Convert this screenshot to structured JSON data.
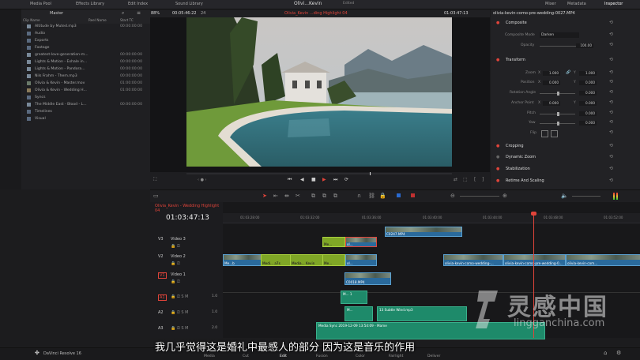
{
  "topbar": {
    "tabs": [
      "Media Pool",
      "Effects Library",
      "Edit Index",
      "Sound Library"
    ],
    "title": "Olivi...Kevin",
    "subtitle": "Edited",
    "right_tabs": [
      "Mixer",
      "Metadata",
      "Inspector"
    ]
  },
  "media_pool": {
    "bin": "Master",
    "col_clip": "Clip Name",
    "col_reel": "Reel Name",
    "col_start": "Start TC",
    "items": [
      {
        "name": "Altitude by Muted.mp3",
        "tc": "00:00:00:00",
        "kind": "audio"
      },
      {
        "name": "Audio",
        "tc": "",
        "kind": "folder"
      },
      {
        "name": "Exports",
        "tc": "",
        "kind": "folder"
      },
      {
        "name": "Footage",
        "tc": "",
        "kind": "folder"
      },
      {
        "name": "greatest-love-generation-m...",
        "tc": "00:00:00:00",
        "kind": "audio"
      },
      {
        "name": "Lights & Motion - Exhale in...",
        "tc": "00:00:00:00",
        "kind": "audio"
      },
      {
        "name": "Lights & Motion - Pandora...",
        "tc": "00:00:00:00",
        "kind": "audio"
      },
      {
        "name": "Nils Frahm - Them.mp3",
        "tc": "00:00:00:00",
        "kind": "audio"
      },
      {
        "name": "Olivia & Kevin - Master.mov",
        "tc": "01:00:00:00",
        "kind": "video"
      },
      {
        "name": "Olivia & Kevin - Wedding H...",
        "tc": "01:00:00:00",
        "kind": "timeline"
      },
      {
        "name": "Syncs",
        "tc": "",
        "kind": "folder"
      },
      {
        "name": "The Middle East - Blood - L...",
        "tc": "00:00:00:00",
        "kind": "audio"
      },
      {
        "name": "Timelines",
        "tc": "",
        "kind": "folder"
      },
      {
        "name": "Visual",
        "tc": "",
        "kind": "folder"
      }
    ]
  },
  "viewer": {
    "zoom": "88%",
    "source_tc": "00:05:46:22",
    "fps": "24",
    "timeline_name": "Olivia_Kevin ...ding Highlight 04",
    "record_tc": "01:03:47:13"
  },
  "inspector": {
    "clip": "olivia-kevin-como-pre-wedding-0027.MP4",
    "composite": "Composite",
    "composite_mode_label": "Composite Mode",
    "composite_mode": "Darken",
    "opacity_label": "Opacity",
    "opacity": "100.00",
    "transform": "Transform",
    "zoom_label": "Zoom",
    "zoom_x": "1.000",
    "zoom_y": "1.000",
    "position_label": "Position",
    "pos_x": "0.000",
    "pos_y": "0.000",
    "rotation_label": "Rotation Angle",
    "rotation": "0.000",
    "anchor_label": "Anchor Point",
    "anchor_x": "0.000",
    "anchor_y": "0.000",
    "pitch_label": "Pitch",
    "pitch": "0.000",
    "yaw_label": "Yaw",
    "yaw": "0.000",
    "flip_label": "Flip",
    "cropping": "Cropping",
    "dynamic_zoom": "Dynamic Zoom",
    "stabilization": "Stabilization",
    "retime": "Retime And Scaling"
  },
  "timeline": {
    "tab": "Olivia_Kevin - Wedding Highlight 04",
    "tc": "01:03:47:13",
    "ruler": [
      "01:03:28:00",
      "01:03:32:00",
      "01:03:36:00",
      "01:03:40:00",
      "01:03:44:00",
      "01:03:48:00",
      "01:03:52:00"
    ],
    "tracks": [
      {
        "id": "V3",
        "name": "Video 3"
      },
      {
        "id": "V2",
        "name": "Video 2"
      },
      {
        "id": "V1",
        "name": "Video 1"
      },
      {
        "id": "A1",
        "name": "",
        "vol": "1.0"
      },
      {
        "id": "A2",
        "name": "",
        "vol": "1.0"
      },
      {
        "id": "A3",
        "name": "",
        "vol": "2.0"
      }
    ],
    "clips": {
      "v3a": "C0247.MP4",
      "v3b": "Me...",
      "v3c": "ol...",
      "v2a": "Me...b",
      "v2b": "Medi... a7s",
      "v2c": "Media... Kevin",
      "v2d": "Me...",
      "v2e": "ol...",
      "v2f": "olivia-kevin-como-wedding-...",
      "v2g": "olivia-kevin-como-pre-wedding-0...",
      "v2h": "olivia-kevin-com...",
      "v1a": "C0018.MP4",
      "a1": "M... 1",
      "a2a": "M...",
      "a2b": "13 Subtle Wind.mp3",
      "a3": "Media Sync 2019-12-09 13:54:09 - Mame"
    }
  },
  "bottombar": {
    "app": "DaVinci Resolve 16",
    "pages": [
      "Media",
      "Cut",
      "Edit",
      "Fusion",
      "Color",
      "Fairlight",
      "Deliver"
    ],
    "active": "Edit"
  },
  "subtitle_text": "我几乎觉得这是婚礼中最感人的部分 因为这是音乐的作用",
  "watermark": {
    "cn": "灵感中国",
    "en": "lingganchina.com"
  },
  "colors": {
    "playhead": "#e0443a",
    "video_clip": "#2a6a9c",
    "green_clip": "#7fa626",
    "audio_clip": "#1e8a6a",
    "timeline_tab": "#e0443a"
  }
}
